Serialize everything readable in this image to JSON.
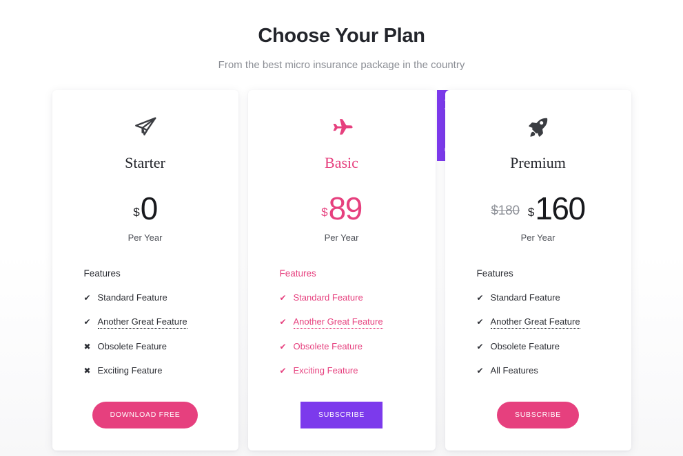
{
  "header": {
    "title": "Choose Your Plan",
    "subtitle": "From the best micro insurance package in the country"
  },
  "colors": {
    "pink": "#e6407e",
    "purple": "#7c3aec",
    "dark": "#23252b",
    "muted": "#8a8d94",
    "page_bg": "#ffffff",
    "card_bg": "#ffffff"
  },
  "plans": [
    {
      "id": "starter",
      "icon": "paper-plane-icon",
      "name": "Starter",
      "currency": "$",
      "price": "0",
      "old_price": "",
      "period": "Per Year",
      "features_title": "Features",
      "features": [
        {
          "mark": "check",
          "label": "Standard Feature",
          "dotted": false
        },
        {
          "mark": "check",
          "label": "Another Great Feature",
          "dotted": true
        },
        {
          "mark": "cross",
          "label": "Obsolete Feature",
          "dotted": false
        },
        {
          "mark": "cross",
          "label": "Exciting Feature",
          "dotted": false
        }
      ],
      "cta_label": "DOWNLOAD FREE",
      "cta_style": "pill",
      "recommended": false,
      "ribbon_label": ""
    },
    {
      "id": "basic",
      "icon": "airplane-icon",
      "name": "Basic",
      "currency": "$",
      "price": "89",
      "old_price": "",
      "period": "Per Year",
      "features_title": "Features",
      "features": [
        {
          "mark": "check",
          "label": "Standard Feature",
          "dotted": false
        },
        {
          "mark": "check",
          "label": "Another Great Feature",
          "dotted": true
        },
        {
          "mark": "check",
          "label": "Obsolete Feature",
          "dotted": false
        },
        {
          "mark": "check",
          "label": "Exciting Feature",
          "dotted": false
        }
      ],
      "cta_label": "SUBSCRIBE",
      "cta_style": "square",
      "recommended": true,
      "ribbon_label": "Recommended"
    },
    {
      "id": "premium",
      "icon": "rocket-icon",
      "name": "Premium",
      "currency": "$",
      "price": "160",
      "old_price": "$180",
      "period": "Per Year",
      "features_title": "Features",
      "features": [
        {
          "mark": "check",
          "label": "Standard Feature",
          "dotted": false
        },
        {
          "mark": "check",
          "label": "Another Great Feature",
          "dotted": true
        },
        {
          "mark": "check",
          "label": "Obsolete Feature",
          "dotted": false
        },
        {
          "mark": "check",
          "label": "All Features",
          "dotted": false
        }
      ],
      "cta_label": "SUBSCRIBE",
      "cta_style": "pill",
      "recommended": false,
      "ribbon_label": ""
    }
  ],
  "glyphs": {
    "check": "✔",
    "cross": "✖"
  }
}
